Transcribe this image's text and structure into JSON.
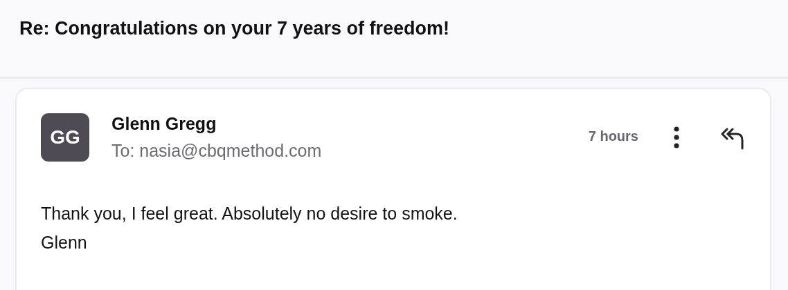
{
  "thread": {
    "subject": "Re: Congratulations on your 7 years of freedom!"
  },
  "message": {
    "avatar_initials": "GG",
    "sender": "Glenn Gregg",
    "recipient": "To: nasia@cbqmethod.com",
    "time": "7 hours",
    "body": [
      "Thank you, I feel great. Absolutely no desire to smoke.",
      "Glenn"
    ]
  }
}
